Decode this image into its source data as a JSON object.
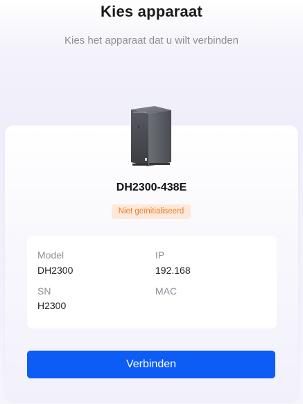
{
  "header": {
    "title": "Kies apparaat",
    "subtitle": "Kies het apparaat dat u wilt verbinden"
  },
  "device": {
    "image_icon": "nas-device-icon",
    "name": "DH2300-438E",
    "status": "Niet geïnitialiseerd",
    "status_color": "#f07a1e",
    "status_bg": "#fde9dc"
  },
  "info": {
    "model_label": "Model",
    "model_value": "DH2300",
    "ip_label": "IP",
    "ip_value": "192.168",
    "sn_label": "SN",
    "sn_value": "H2300",
    "mac_label": "MAC",
    "mac_value": ""
  },
  "actions": {
    "connect_label": "Verbinden",
    "accent_color": "#0d5cf5"
  }
}
